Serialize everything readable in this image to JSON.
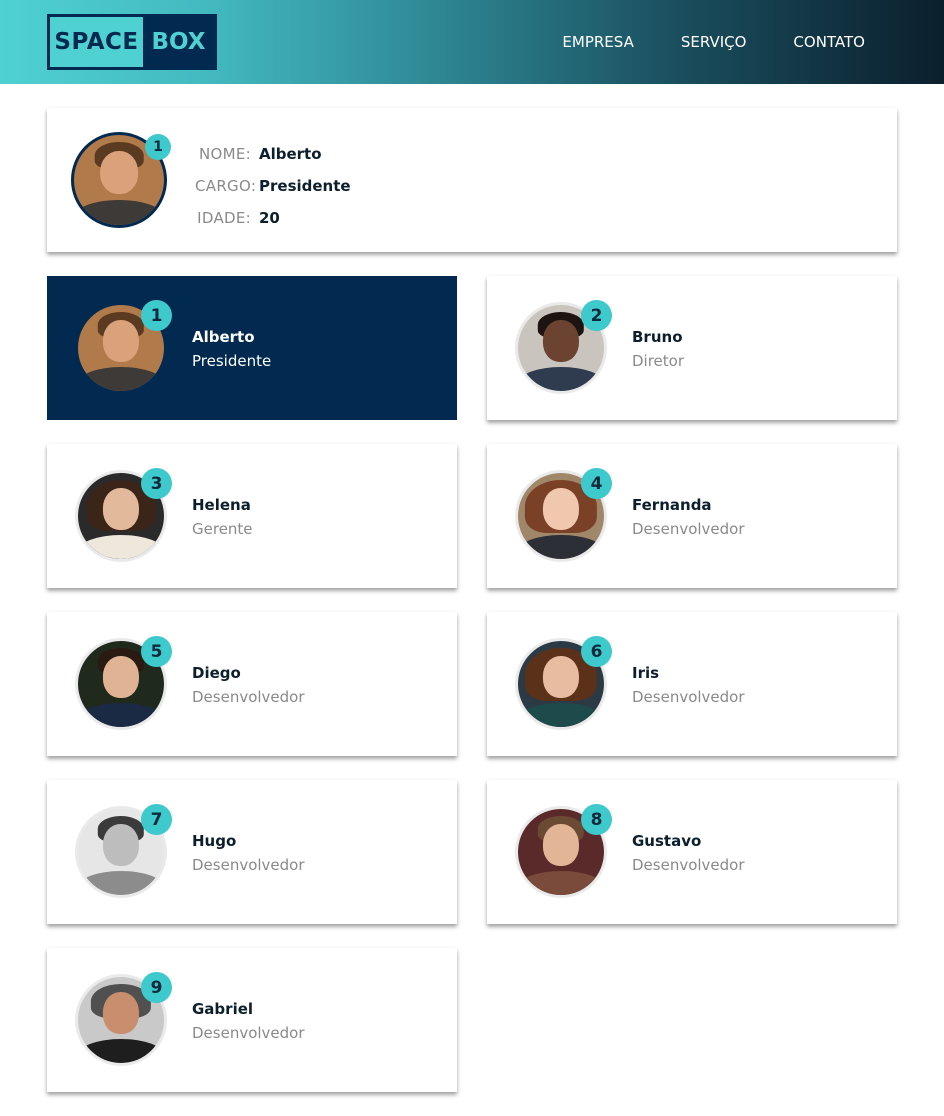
{
  "header": {
    "logo_part1": "SPACE",
    "logo_part2": "BOX",
    "nav": [
      "EMPRESA",
      "SERVIÇO",
      "CONTATO"
    ]
  },
  "profile": {
    "badge": "1",
    "rows": [
      {
        "label": "NOME:",
        "value": "Alberto"
      },
      {
        "label": "CARGO:",
        "value": "Presidente"
      },
      {
        "label": "IDADE:",
        "value": "20"
      }
    ]
  },
  "members": [
    {
      "number": "1",
      "name": "Alberto",
      "role": "Presidente",
      "active": true
    },
    {
      "number": "2",
      "name": "Bruno",
      "role": "Diretor",
      "active": false
    },
    {
      "number": "3",
      "name": "Helena",
      "role": "Gerente",
      "active": false
    },
    {
      "number": "4",
      "name": "Fernanda",
      "role": "Desenvolvedor",
      "active": false
    },
    {
      "number": "5",
      "name": "Diego",
      "role": "Desenvolvedor",
      "active": false
    },
    {
      "number": "6",
      "name": "Iris",
      "role": "Desenvolvedor",
      "active": false
    },
    {
      "number": "7",
      "name": "Hugo",
      "role": "Desenvolvedor",
      "active": false
    },
    {
      "number": "8",
      "name": "Gustavo",
      "role": "Desenvolvedor",
      "active": false
    },
    {
      "number": "9",
      "name": "Gabriel",
      "role": "Desenvolvedor",
      "active": false
    }
  ],
  "colors": {
    "accent": "#3ec9cc",
    "navy": "#022a50",
    "muted_text": "#8a8a8a"
  }
}
